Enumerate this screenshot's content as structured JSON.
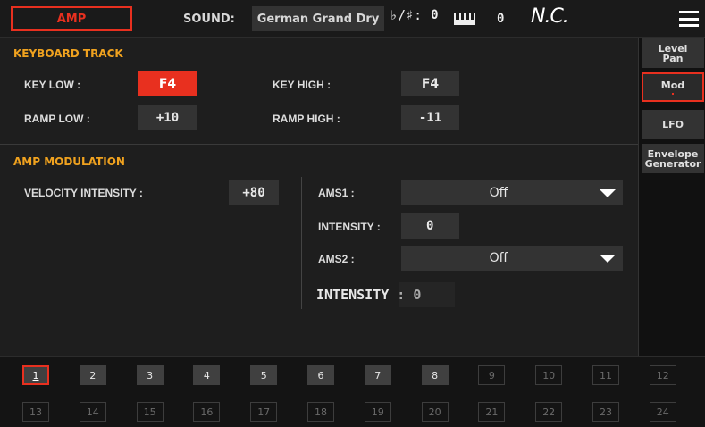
{
  "header": {
    "mode_tab": "AMP",
    "sound_label": "SOUND:",
    "sound_value": "German Grand Dry",
    "key_signature_label": "♭/♯:",
    "key_signature_value": "0",
    "transpose_value": "0",
    "chord": "N.C."
  },
  "keyboard_track": {
    "title": "KEYBOARD TRACK",
    "key_low_label": "KEY LOW :",
    "key_low_value": "F4",
    "key_high_label": "KEY HIGH :",
    "key_high_value": "F4",
    "ramp_low_label": "RAMP LOW :",
    "ramp_low_value": "+10",
    "ramp_high_label": "RAMP HIGH :",
    "ramp_high_value": "-11"
  },
  "amp_modulation": {
    "title": "AMP MODULATION",
    "velocity_intensity_label": "VELOCITY INTENSITY :",
    "velocity_intensity_value": "+80",
    "ams1_label": "AMS1 :",
    "ams1_value": "Off",
    "intensity1_label": "INTENSITY :",
    "intensity1_value": "0",
    "ams2_label": "AMS2 :",
    "ams2_value": "Off",
    "intensity2_text": "INTENSITY : 0"
  },
  "side_tabs": [
    {
      "line1": "Level",
      "line2": "Pan"
    },
    {
      "line1": "Mod",
      "line2": ""
    },
    {
      "line1": "LFO",
      "line2": ""
    },
    {
      "line1": "Envelope",
      "line2": "Generator"
    }
  ],
  "selected_side_tab": "Mod",
  "layers": {
    "row1": [
      "1",
      "2",
      "3",
      "4",
      "5",
      "6",
      "7",
      "8",
      "9",
      "10",
      "11",
      "12"
    ],
    "row2": [
      "13",
      "14",
      "15",
      "16",
      "17",
      "18",
      "19",
      "20",
      "21",
      "22",
      "23",
      "24"
    ],
    "selected": "1"
  },
  "colors": {
    "accent": "#e8301f",
    "section_title": "#f0a21f",
    "panel_bg": "#1e1e1e",
    "field_bg": "#333333"
  },
  "icons": {
    "menu": "hamburger-menu-icon",
    "keyboard": "piano-keyboard-icon",
    "dropdown": "chevron-down-icon"
  }
}
